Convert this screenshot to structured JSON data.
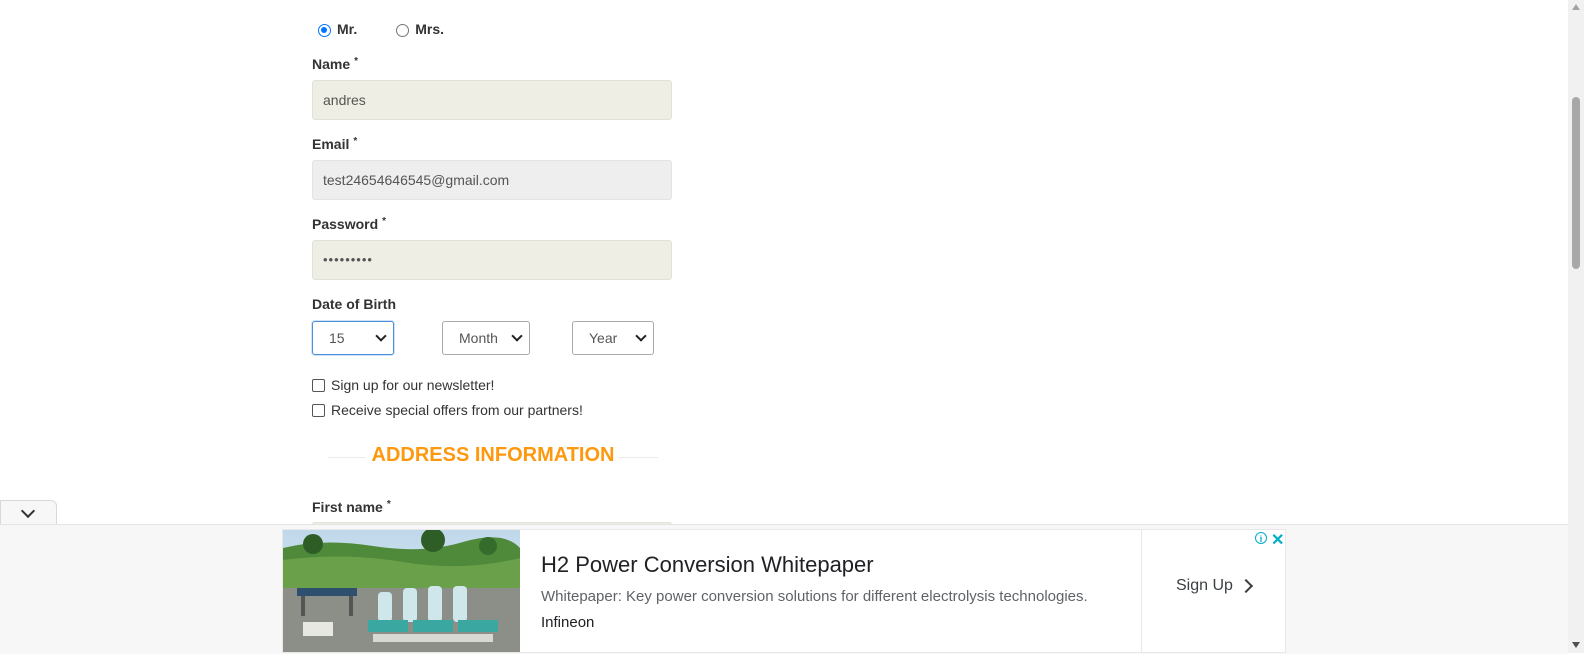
{
  "form": {
    "title_options": [
      {
        "label": "Mr.",
        "checked": true
      },
      {
        "label": "Mrs.",
        "checked": false
      }
    ],
    "name": {
      "label": "Name",
      "required_mark": "*",
      "value": "andres"
    },
    "email": {
      "label": "Email",
      "required_mark": "*",
      "value": "test24654646545@gmail.com"
    },
    "password": {
      "label": "Password",
      "required_mark": "*",
      "value": "•••••••••"
    },
    "dob": {
      "label": "Date of Birth",
      "day": "15",
      "month": "Month",
      "year": "Year"
    },
    "newsletter_label": "Sign up for our newsletter!",
    "offers_label": "Receive special offers from our partners!",
    "address_section_title": "ADDRESS INFORMATION",
    "first_name": {
      "label": "First name",
      "required_mark": "*"
    }
  },
  "ad": {
    "title": "H2 Power Conversion Whitepaper",
    "description": "Whitepaper: Key power conversion solutions for different electrolysis technologies.",
    "brand": "Infineon",
    "cta": "Sign Up",
    "info_icon": "i",
    "close_icon": "✕"
  },
  "colors": {
    "accent_orange": "#fe980f",
    "radio_blue": "#0075ff",
    "ad_icon_teal": "#00aecd"
  }
}
